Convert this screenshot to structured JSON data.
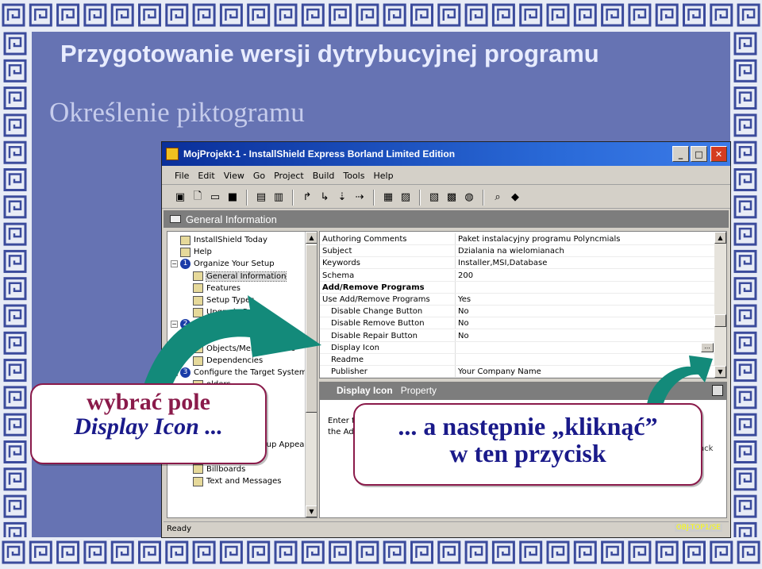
{
  "slide": {
    "title": "Przygotowanie wersji dytrybucyjnej programu",
    "subtitle": "Określenie piktogramu"
  },
  "window": {
    "title": "MojProjekt-1 - InstallShield Express Borland Limited Edition",
    "buttons": {
      "minimize": "_",
      "maximize": "□",
      "close": "✕"
    },
    "menu": [
      "File",
      "Edit",
      "View",
      "Go",
      "Project",
      "Build",
      "Tools",
      "Help"
    ],
    "toolbar_icons": [
      "new-icon",
      "open-icon",
      "save-icon",
      "view-icon",
      "view2-icon",
      "back-icon",
      "forward-icon",
      "next-icon",
      "build-icon",
      "test-icon",
      "run-icon",
      "release-icon",
      "web-icon",
      "help-icon"
    ],
    "panel_header": "General Information",
    "tree": [
      {
        "label": "InstallShield Today",
        "level": 1
      },
      {
        "label": "Help",
        "level": 1
      },
      {
        "label": "Organize Your Setup",
        "level": 0,
        "num": "1"
      },
      {
        "label": "General Information",
        "level": 2,
        "selected": true
      },
      {
        "label": "Features",
        "level": 2
      },
      {
        "label": "Setup Types",
        "level": 2
      },
      {
        "label": "Upgrade Paths",
        "level": 2
      },
      {
        "label": "...ata",
        "level": 0,
        "num": "2"
      },
      {
        "label": "Fil",
        "level": 2
      },
      {
        "label": "Objects/Merge Module",
        "level": 2
      },
      {
        "label": "Dependencies",
        "level": 2
      },
      {
        "label": "Configure the Target System",
        "level": 0,
        "num": "3"
      },
      {
        "label": "olders",
        "level": 2
      },
      {
        "label": "rres",
        "level": 2
      },
      {
        "label": "ges",
        "level": 2
      },
      {
        "label": "ns",
        "level": 2
      },
      {
        "label": "Variables",
        "level": 2
      },
      {
        "label": "Customize the Setup Appeara",
        "level": 0,
        "num": "4"
      },
      {
        "label": "Dialogs",
        "level": 2
      },
      {
        "label": "Billboards",
        "level": 2
      },
      {
        "label": "Text and Messages",
        "level": 2
      }
    ],
    "properties": [
      {
        "key": "Authoring Comments",
        "value": "Paket instalacyjny programu Polyncmials"
      },
      {
        "key": "Subject",
        "value": "Dzialania na wielomianach"
      },
      {
        "key": "Keywords",
        "value": "Installer,MSI,Database"
      },
      {
        "key": "Schema",
        "value": "200"
      },
      {
        "key": "Add/Remove Programs",
        "value": "",
        "bold": true
      },
      {
        "key": "Use Add/Remove Programs",
        "value": "Yes"
      },
      {
        "key": "Disable Change Button",
        "value": "No",
        "indent": true
      },
      {
        "key": "Disable Remove Button",
        "value": "No",
        "indent": true
      },
      {
        "key": "Disable Repair Button",
        "value": "No",
        "indent": true
      },
      {
        "key": "Display Icon",
        "value": "",
        "indent": true,
        "ellipsis": "..."
      },
      {
        "key": "Readme",
        "value": "",
        "indent": true
      },
      {
        "key": "Publisher",
        "value": "Your Company Name",
        "indent": true
      }
    ],
    "help_bar": {
      "title": "Display Icon",
      "suffix": "Property"
    },
    "help_text": [
      "Enter t",
      "the Ad"
    ],
    "help_side": "ack",
    "status_left": "Ready",
    "status_right": "OBJ-TOP1/SE"
  },
  "callouts": {
    "left_line1": "wybrać pole",
    "left_line2": "Display Icon ...",
    "right_line1": "... a następnie „kliknąć”",
    "right_line2": "w ten przycisk"
  },
  "colors": {
    "background": "#6673b3",
    "callout_border": "#8a1a4a",
    "arrow": "#138a7a"
  }
}
